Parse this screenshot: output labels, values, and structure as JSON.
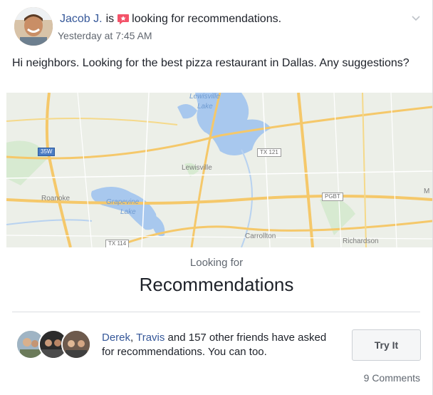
{
  "post": {
    "author": "Jacob J.",
    "is_text": "is",
    "status": "looking for recommendations.",
    "timestamp": "Yesterday at 7:45 AM",
    "body": "Hi neighbors. Looking for the best pizza restaurant in Dallas. Any suggestions?"
  },
  "map": {
    "labels": {
      "lake_lewisville_1": "Lewisville",
      "lake_lewisville_2": "Lake",
      "lewisville": "Lewisville",
      "roanoke": "Roanoke",
      "grapevine_1": "Grapevine",
      "grapevine_2": "Lake",
      "carrollton": "Carrollton",
      "richardson": "Richardson",
      "edge_m": "M"
    },
    "shields": {
      "i35w": "35W",
      "tx121": "TX 121",
      "pgbt": "PGBT",
      "tx114": "TX 114"
    }
  },
  "card": {
    "looking_for": "Looking for",
    "title": "Recommendations"
  },
  "social": {
    "friend1": "Derek",
    "separator": ", ",
    "friend2": "Travis",
    "text": " and 157 other friends have asked for recommendations. You can too.",
    "button": "Try It",
    "comments": "9 Comments"
  },
  "colors": {
    "link": "#365899",
    "accent_icon": "#f35369",
    "secondary_text": "#616770"
  },
  "icons": [
    "recommendations-icon",
    "chevron-down-icon"
  ]
}
